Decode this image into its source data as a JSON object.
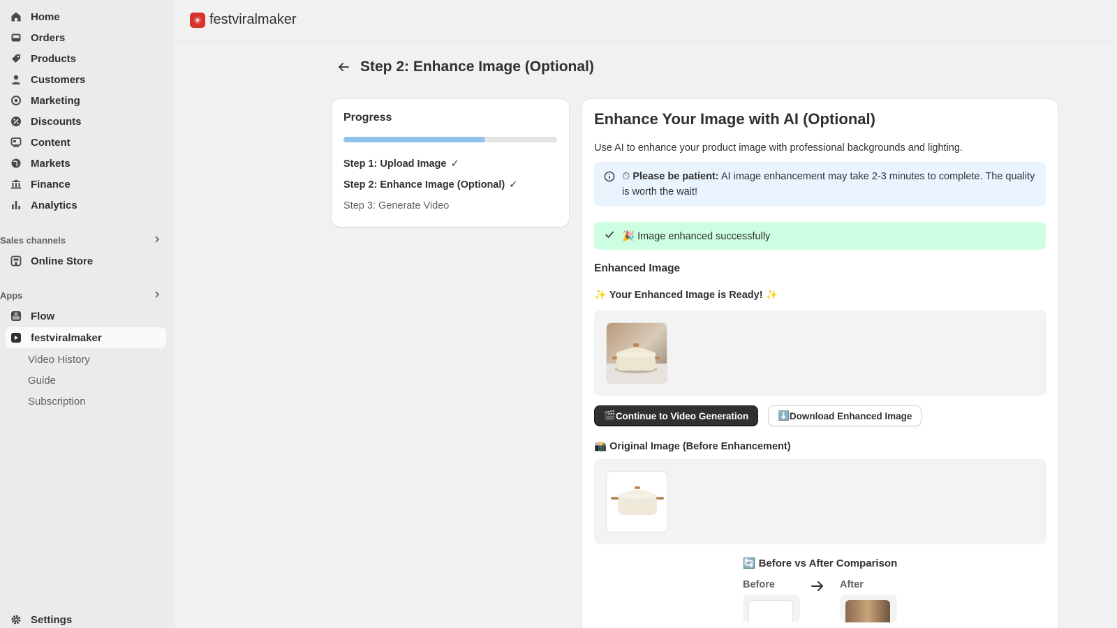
{
  "sidebar": {
    "items": [
      {
        "label": "Home",
        "icon": "home-icon"
      },
      {
        "label": "Orders",
        "icon": "inbox-icon"
      },
      {
        "label": "Products",
        "icon": "tag-icon"
      },
      {
        "label": "Customers",
        "icon": "person-icon"
      },
      {
        "label": "Marketing",
        "icon": "target-icon"
      },
      {
        "label": "Discounts",
        "icon": "discount-icon"
      },
      {
        "label": "Content",
        "icon": "content-icon"
      },
      {
        "label": "Markets",
        "icon": "globe-icon"
      },
      {
        "label": "Finance",
        "icon": "bank-icon"
      },
      {
        "label": "Analytics",
        "icon": "bar-chart-icon"
      }
    ],
    "sales_channels_label": "Sales channels",
    "online_store_label": "Online Store",
    "apps_label": "Apps",
    "flow_label": "Flow",
    "app_label": "festviralmaker",
    "app_subitems": [
      "Video History",
      "Guide",
      "Subscription"
    ],
    "settings_label": "Settings"
  },
  "topbar": {
    "brand_name": "festviralmaker"
  },
  "page": {
    "title": "Step 2: Enhance Image (Optional)"
  },
  "progress": {
    "title": "Progress",
    "fraction": 0.66,
    "steps": [
      {
        "label": "Step 1: Upload Image",
        "mark": "✓"
      },
      {
        "label": "Step 2: Enhance Image (Optional)",
        "mark": "✓"
      },
      {
        "label": "Step 3: Generate Video",
        "mark": ""
      }
    ]
  },
  "main": {
    "title": "Enhance Your Image with AI (Optional)",
    "description": "Use AI to enhance your product image with professional backgrounds and lighting.",
    "info_emoji": "⏱",
    "info_bold": "Please be patient:",
    "info_text": " AI image enhancement may take 2-3 minutes to complete. The quality is worth the wait!",
    "success_emoji": "🎉",
    "success_text": " Image enhanced successfully",
    "enhanced_heading": "Enhanced Image",
    "ready_sparkle": "✨",
    "ready_text": " Your Enhanced Image is Ready! ",
    "continue_emoji": "🎬",
    "continue_label": " Continue to Video Generation",
    "download_emoji": "⬇️",
    "download_label": " Download Enhanced Image",
    "original_emoji": "📸",
    "original_text": " Original Image (Before Enhancement)",
    "compare_emoji": "🔄",
    "compare_title": " Before vs After Comparison",
    "before_label": "Before",
    "after_label": "After"
  },
  "colors": {
    "progress_fill": "#8fc1ea",
    "info_bg": "#eaf4ff",
    "success_bg": "#cdfee1",
    "primary_button": "#303030",
    "brand": "#d9342b"
  }
}
